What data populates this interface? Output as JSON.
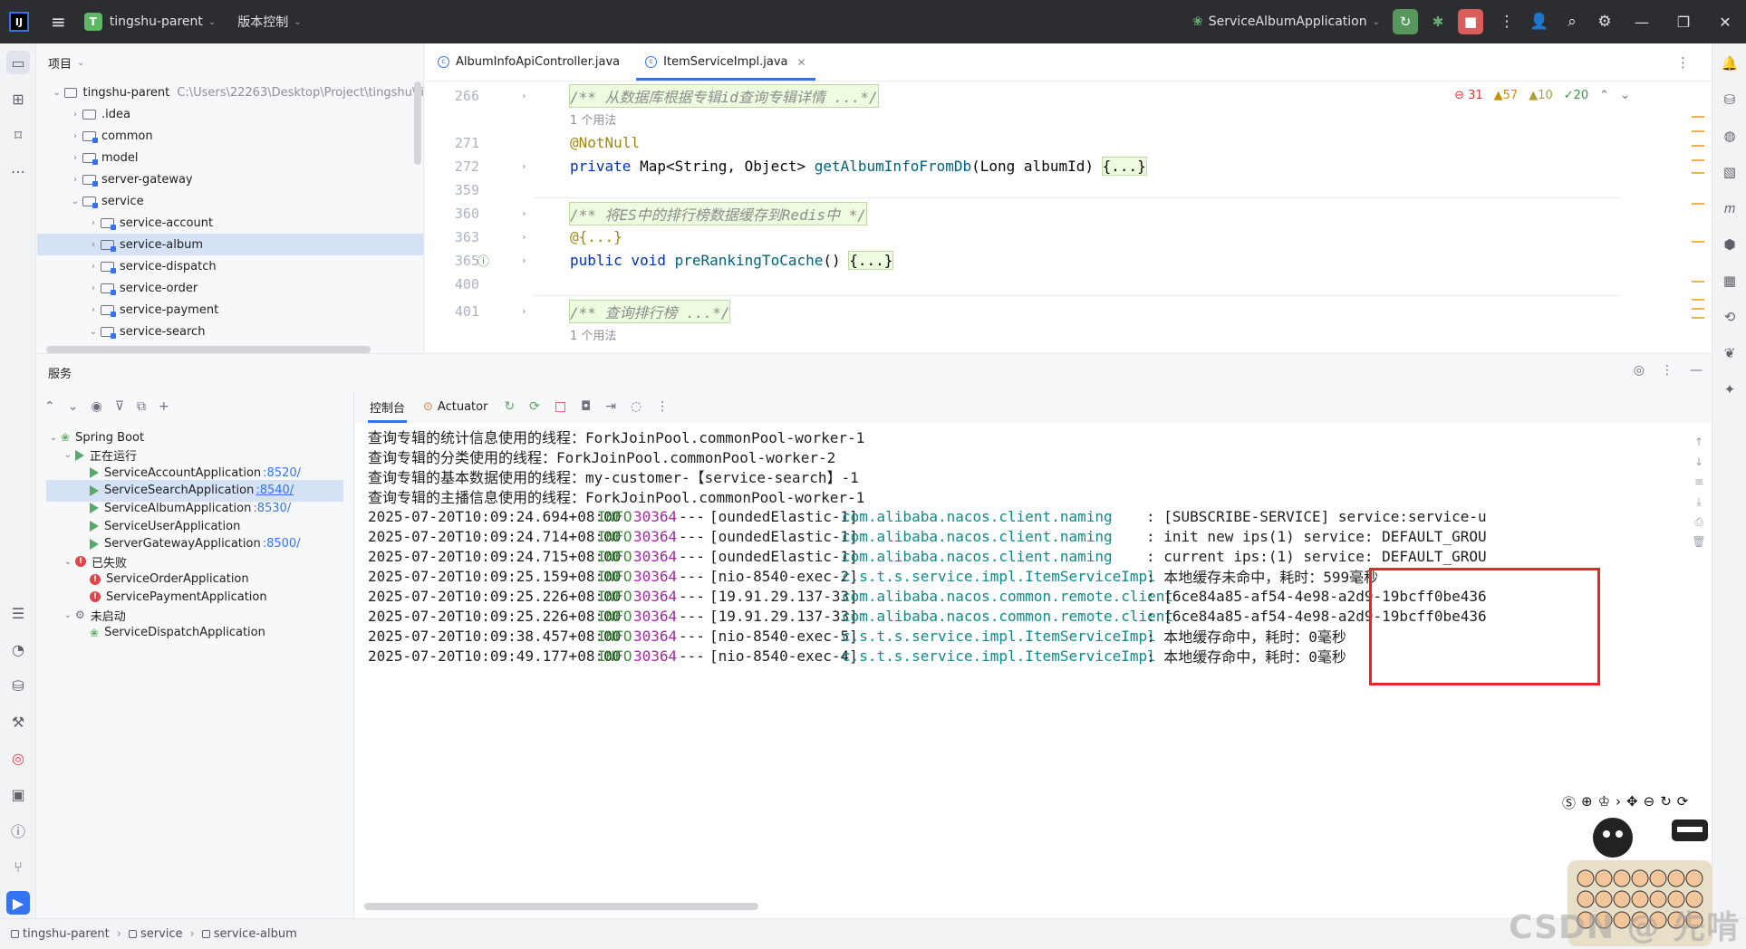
{
  "titlebar": {
    "logo": "IJ",
    "project_badge": "T",
    "project_name": "tingshu-parent",
    "vcs_label": "版本控制",
    "run_config": "ServiceAlbumApplication"
  },
  "project_panel": {
    "title": "项目",
    "tree": [
      {
        "label": "tingshu-parent",
        "path": "C:\\Users\\22263\\Desktop\\Project\\tingshu\\ti",
        "depth": 0,
        "expanded": true,
        "selected": false
      },
      {
        "label": ".idea",
        "depth": 1,
        "expanded": false,
        "selected": false
      },
      {
        "label": "common",
        "depth": 1,
        "expanded": false,
        "selected": false
      },
      {
        "label": "model",
        "depth": 1,
        "expanded": false,
        "selected": false
      },
      {
        "label": "server-gateway",
        "depth": 1,
        "expanded": false,
        "selected": false
      },
      {
        "label": "service",
        "depth": 1,
        "expanded": true,
        "selected": false
      },
      {
        "label": "service-account",
        "depth": 2,
        "expanded": false,
        "selected": false
      },
      {
        "label": "service-album",
        "depth": 2,
        "expanded": false,
        "selected": true
      },
      {
        "label": "service-dispatch",
        "depth": 2,
        "expanded": false,
        "selected": false
      },
      {
        "label": "service-order",
        "depth": 2,
        "expanded": false,
        "selected": false
      },
      {
        "label": "service-payment",
        "depth": 2,
        "expanded": false,
        "selected": false
      },
      {
        "label": "service-search",
        "depth": 2,
        "expanded": true,
        "selected": false
      }
    ]
  },
  "editor": {
    "tabs": [
      {
        "label": "AlbumInfoApiController.java",
        "active": false
      },
      {
        "label": "ItemServiceImpl.java",
        "active": true
      }
    ],
    "inspections": {
      "errors": "31",
      "warnings": "57",
      "weak_warnings": "10",
      "typos": "20"
    },
    "lines": [
      {
        "num": "266",
        "kind": "doc",
        "text": "/** 从数据库根据专辑id查询专辑详情 ...*/"
      },
      {
        "num": "",
        "kind": "usage",
        "text": "1 个用法"
      },
      {
        "num": "271",
        "kind": "annotation",
        "text": "@NotNull"
      },
      {
        "num": "272",
        "kind": "method",
        "text": "private Map<String, Object> getAlbumInfoFromDb(Long albumId) {...}"
      },
      {
        "num": "359",
        "kind": "blank",
        "text": ""
      },
      {
        "num": "360",
        "kind": "doc",
        "text": "/** 将ES中的排行榜数据缓存到Redis中 */"
      },
      {
        "num": "363",
        "kind": "annotation",
        "text": "@{...}"
      },
      {
        "num": "365",
        "kind": "method2",
        "text": "public void preRankingToCache() {...}"
      },
      {
        "num": "400",
        "kind": "blank",
        "text": ""
      },
      {
        "num": "401",
        "kind": "doc",
        "text": "/** 查询排行榜 ...*/"
      },
      {
        "num": "",
        "kind": "usage",
        "text": "1 个用法"
      }
    ],
    "code_parts": {
      "l272_kw": "private",
      "l272_type": " Map<String, Object> ",
      "l272_fn": "getAlbumInfoFromDb",
      "l272_args": "(Long albumId) ",
      "l272_body": "{...}",
      "l365_kw": "public void",
      "l365_fn": " preRankingToCache",
      "l365_args": "() ",
      "l365_body": "{...}"
    }
  },
  "services": {
    "title": "服务",
    "tree": {
      "root": "Spring Boot",
      "running_label": "正在运行",
      "running": [
        {
          "name": "ServiceAccountApplication",
          "port": ":8520/",
          "selected": false
        },
        {
          "name": "ServiceSearchApplication",
          "port": ":8540/",
          "selected": true
        },
        {
          "name": "ServiceAlbumApplication",
          "port": ":8530/",
          "selected": false
        },
        {
          "name": "ServiceUserApplication",
          "port": "",
          "selected": false
        },
        {
          "name": "ServerGatewayApplication",
          "port": ":8500/",
          "selected": false
        }
      ],
      "failed_label": "已失败",
      "failed": [
        {
          "name": "ServiceOrderApplication"
        },
        {
          "name": "ServicePaymentApplication"
        }
      ],
      "not_started_label": "未启动",
      "not_started": [
        {
          "name": "ServiceDispatchApplication"
        }
      ]
    },
    "console_tabs": [
      {
        "label": "控制台",
        "active": true
      },
      {
        "label": "Actuator",
        "active": false
      }
    ],
    "console_plain_lines": [
      "查询专辑的统计信息使用的线程：ForkJoinPool.commonPool-worker-1",
      "查询专辑的分类使用的线程：ForkJoinPool.commonPool-worker-2",
      "查询专辑的基本数据使用的线程：my-customer-【service-search】-1",
      "查询专辑的主播信息使用的线程：ForkJoinPool.commonPool-worker-1"
    ],
    "console_log_lines": [
      {
        "ts": "2025-07-20T10:09:24.694+08:00",
        "level": "INFO",
        "pid": "30364",
        "dash": "---",
        "thread": "[oundedElastic-1]",
        "logger": "com.alibaba.nacos.client.naming",
        "msg": ": [SUBSCRIBE-SERVICE] service:service-u"
      },
      {
        "ts": "2025-07-20T10:09:24.714+08:00",
        "level": "INFO",
        "pid": "30364",
        "dash": "---",
        "thread": "[oundedElastic-1]",
        "logger": "com.alibaba.nacos.client.naming",
        "msg": ": init new ips(1) service: DEFAULT_GROU"
      },
      {
        "ts": "2025-07-20T10:09:24.715+08:00",
        "level": "INFO",
        "pid": "30364",
        "dash": "---",
        "thread": "[oundedElastic-1]",
        "logger": "com.alibaba.nacos.client.naming",
        "msg": ": current ips:(1) service: DEFAULT_GROU"
      },
      {
        "ts": "2025-07-20T10:09:25.159+08:00",
        "level": "INFO",
        "pid": "30364",
        "dash": "---",
        "thread": "[nio-8540-exec-2]",
        "logger": "c.s.t.s.service.impl.ItemServiceImpl",
        "msg": ": 本地缓存未命中，耗时：599毫秒"
      },
      {
        "ts": "2025-07-20T10:09:25.226+08:00",
        "level": "INFO",
        "pid": "30364",
        "dash": "---",
        "thread": "[19.91.29.137-33]",
        "logger": "com.alibaba.nacos.common.remote.client",
        "msg": ": [6ce84a85-af54-4e98-a2d9-19bcff0be436"
      },
      {
        "ts": "2025-07-20T10:09:25.226+08:00",
        "level": "INFO",
        "pid": "30364",
        "dash": "---",
        "thread": "[19.91.29.137-33]",
        "logger": "com.alibaba.nacos.common.remote.client",
        "msg": ": [6ce84a85-af54-4e98-a2d9-19bcff0be436"
      },
      {
        "ts": "2025-07-20T10:09:38.457+08:00",
        "level": "INFO",
        "pid": "30364",
        "dash": "---",
        "thread": "[nio-8540-exec-5]",
        "logger": "c.s.t.s.service.impl.ItemServiceImpl",
        "msg": ": 本地缓存命中，耗时：0毫秒"
      },
      {
        "ts": "2025-07-20T10:09:49.177+08:00",
        "level": "INFO",
        "pid": "30364",
        "dash": "---",
        "thread": "[nio-8540-exec-4]",
        "logger": "c.s.t.s.service.impl.ItemServiceImpl",
        "msg": ": 本地缓存命中，耗时：0毫秒"
      }
    ]
  },
  "statusbar": {
    "crumbs": [
      "tingshu-parent",
      "service",
      "service-album"
    ]
  },
  "watermark": "CSDN @ 先啃啃",
  "icons": {
    "main_menu": "hamburger-icon",
    "run": "run-icon",
    "debug": "debug-icon",
    "stop": "stop-icon",
    "search": "search-icon",
    "settings": "gear-icon"
  },
  "colors": {
    "titlebar_bg": "#2b2d30",
    "accent": "#3574f0",
    "selection": "#d5e1f5",
    "highlight_box": "#e32626",
    "log_info": "#3e8d3e",
    "log_pid": "#a626a4",
    "log_logger": "#0e8a8a"
  }
}
